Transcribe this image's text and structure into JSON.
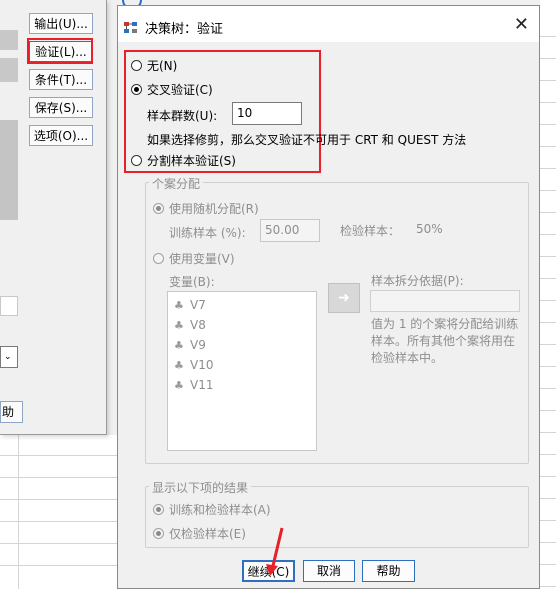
{
  "background_dialog": {
    "buttons": [
      "输出(U)...",
      "验证(L)...",
      "条件(T)...",
      "保存(S)...",
      "选项(O)..."
    ],
    "help_fragment": "助"
  },
  "dialog": {
    "title": "决策树：验证",
    "close_glyph": "✕",
    "options": {
      "none_label": "无(N)",
      "cross_validation_label": "交叉验证(C)",
      "sample_folds_label": "样本群数(U):",
      "sample_folds_value": "10",
      "note": "如果选择修剪，那么交叉验证不可用于 CRT 和 QUEST 方法",
      "split_sample_label": "分割样本验证(S)",
      "selected": "cross_validation"
    },
    "case_allocation": {
      "title": "个案分配",
      "random_label": "使用随机分配(R)",
      "training_label": "训练样本 (%):",
      "training_value": "50.00",
      "test_label": "检验样本：",
      "test_value": "50%",
      "variable_label": "使用变量(V)",
      "variables_label": "变量(B):",
      "variables": [
        "V7",
        "V8",
        "V9",
        "V10",
        "V11"
      ],
      "split_basis_label": "样本拆分依据(P):",
      "split_basis_value": "",
      "split_note": "值为 1 的个案将分配给训练样本。所有其他个案将用在检验样本中。"
    },
    "show_results": {
      "title": "显示以下项的结果",
      "train_test_label": "训练和检验样本(A)",
      "test_only_label": "仅检验样本(E)"
    },
    "footer": {
      "continue_label": "继续(C)",
      "cancel_label": "取消",
      "help_label": "帮助"
    }
  }
}
